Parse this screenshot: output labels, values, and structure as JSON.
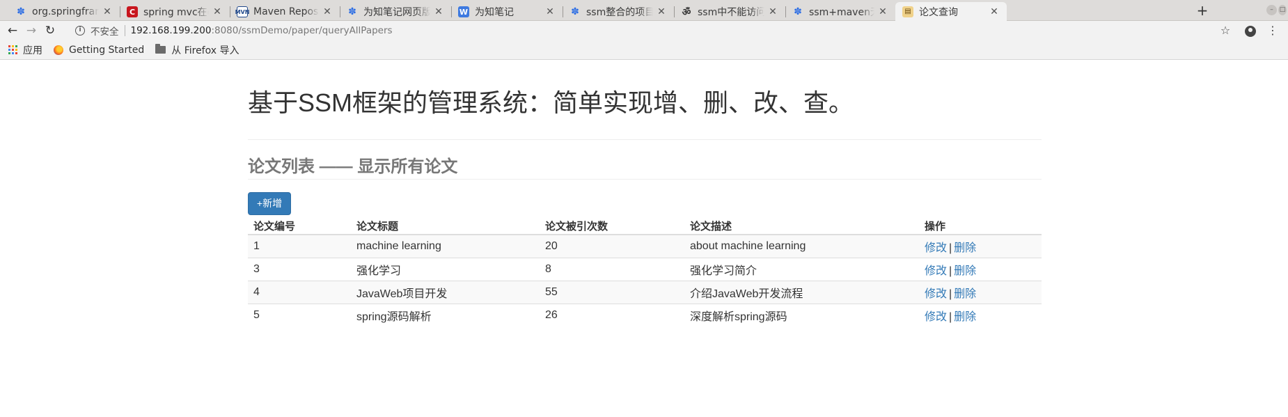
{
  "browser": {
    "tabs": [
      {
        "title": "org.springframew",
        "icon": "baidu-paw-icon"
      },
      {
        "title": "spring mvc在debu",
        "icon": "csdn-icon"
      },
      {
        "title": "Maven Repository",
        "icon": "maven-icon"
      },
      {
        "title": "为知笔记网页版_百",
        "icon": "baidu-paw-icon"
      },
      {
        "title": "为知笔记",
        "icon": "wiz-icon"
      },
      {
        "title": "ssm整合的项目中访",
        "icon": "baidu-paw-icon"
      },
      {
        "title": "ssm中不能访问静态",
        "icon": "om-icon"
      },
      {
        "title": "ssm+maven无法访",
        "icon": "baidu-paw-icon"
      },
      {
        "title": "论文查询",
        "icon": "document-icon",
        "active": true
      }
    ],
    "security_label": "不安全",
    "url_host": "192.168.199.200",
    "url_rest": ":8080/ssmDemo/paper/queryAllPapers",
    "bookmarks": {
      "apps": "应用",
      "getting_started": "Getting Started",
      "firefox_import": "从 Firefox 导入"
    }
  },
  "page": {
    "title": "基于SSM框架的管理系统：简单实现增、删、改、查。",
    "subtitle": "论文列表 —— 显示所有论文",
    "add_button": "+新增",
    "table": {
      "headers": [
        "论文编号",
        "论文标题",
        "论文被引次数",
        "论文描述",
        "操作"
      ],
      "rows": [
        {
          "id": "1",
          "title": "machine learning",
          "citations": "20",
          "description": "about machine learning",
          "edit": "修改",
          "sep": "|",
          "delete": "删除"
        },
        {
          "id": "3",
          "title": "强化学习",
          "citations": "8",
          "description": "强化学习简介",
          "edit": "修改",
          "sep": "|",
          "delete": "删除"
        },
        {
          "id": "4",
          "title": "JavaWeb项目开发",
          "citations": "55",
          "description": "介绍JavaWeb开发流程",
          "edit": "修改",
          "sep": "|",
          "delete": "删除"
        },
        {
          "id": "5",
          "title": "spring源码解析",
          "citations": "26",
          "description": "深度解析spring源码",
          "edit": "修改",
          "sep": "|",
          "delete": "删除"
        }
      ]
    },
    "colors": {
      "primary": "#337ab7",
      "stripe": "#f9f9f9"
    }
  }
}
